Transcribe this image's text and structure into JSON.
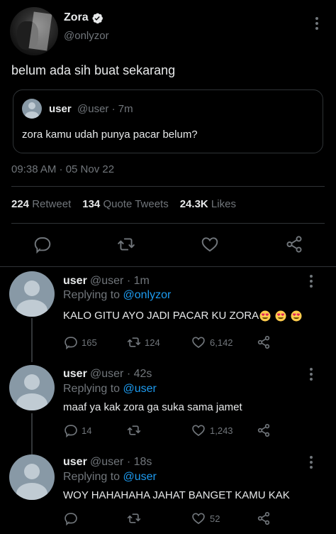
{
  "main_tweet": {
    "display_name": "Zora",
    "handle": "@onlyzor",
    "text": "belum ada sih buat sekarang",
    "timestamp": "09:38 AM · 05 Nov 22",
    "quoted": {
      "name": "user",
      "handle_time": "@user · 7m",
      "text": "zora kamu udah punya pacar belum?"
    },
    "stats": {
      "retweets_count": "224",
      "retweets_label": "Retweet",
      "quotes_count": "134",
      "quotes_label": "Quote Tweets",
      "likes_count": "24.3K",
      "likes_label": "Likes"
    }
  },
  "replies": [
    {
      "name": "user",
      "handle_time": "@user · 1m",
      "replying_prefix": "Replying to",
      "replying_to": "@onlyzor",
      "text": "KALO GITU AYO JADI PACAR KU ZORA",
      "emoji": [
        "heart-eyes-emoji",
        "heart-eyes-emoji",
        "heart-eyes-emoji"
      ],
      "replies": "165",
      "retweets": "124",
      "likes": "6,142"
    },
    {
      "name": "user",
      "handle_time": "@user · 42s",
      "replying_prefix": "Replying to",
      "replying_to": "@user",
      "text": "maaf ya kak zora ga suka sama jamet",
      "replies": "14",
      "retweets": "",
      "likes": "1,243"
    },
    {
      "name": "user",
      "handle_time": "@user · 18s",
      "replying_prefix": "Replying to",
      "replying_to": "@user",
      "text": "WOY HAHAHAHA JAHAT BANGET KAMU KAK",
      "replies": "",
      "retweets": "",
      "likes": "52"
    }
  ],
  "colors": {
    "background": "#000000",
    "text": "#e7e9ea",
    "muted": "#71767b",
    "accent": "#1d9bf0",
    "divider": "#2f3336"
  }
}
